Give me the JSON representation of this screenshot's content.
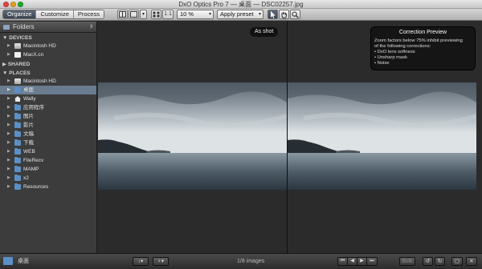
{
  "window": {
    "title": "DxO Optics Pro 7 — 桌面 — DSC02257.jpg"
  },
  "toolbar": {
    "tabs": [
      {
        "label": "Organize",
        "active": true
      },
      {
        "label": "Customize",
        "active": false
      },
      {
        "label": "Process",
        "active": false
      }
    ],
    "one_to_one_label": "1:1",
    "zoom_value": "10 %",
    "preset_label": "Apply preset"
  },
  "sidebar": {
    "header": "Folders",
    "sections": [
      {
        "title": "DEVICES",
        "items": [
          {
            "label": "Macintosh HD",
            "icon": "drive-icon"
          },
          {
            "label": "MacX.cn",
            "icon": "drive-icon"
          }
        ]
      },
      {
        "title": "SHARED",
        "items": []
      },
      {
        "title": "PLACES",
        "items": [
          {
            "label": "Macintosh HD",
            "icon": "drive-icon"
          },
          {
            "label": "桌面",
            "icon": "folder-icon",
            "selected": true
          },
          {
            "label": "Wally",
            "icon": "home-icon"
          },
          {
            "label": "应用程序",
            "icon": "folder-icon"
          },
          {
            "label": "图片",
            "icon": "folder-icon"
          },
          {
            "label": "影片",
            "icon": "folder-icon"
          },
          {
            "label": "文稿",
            "icon": "folder-icon"
          },
          {
            "label": "下载",
            "icon": "folder-icon"
          },
          {
            "label": "WEB",
            "icon": "folder-icon"
          },
          {
            "label": "FileRecv",
            "icon": "folder-icon"
          },
          {
            "label": "MAMP",
            "icon": "folder-icon"
          },
          {
            "label": "x2",
            "icon": "folder-icon"
          },
          {
            "label": "Resources",
            "icon": "folder-icon"
          }
        ]
      }
    ]
  },
  "viewer": {
    "as_shot_label": "As shot",
    "preview": {
      "title": "Correction Preview",
      "lines": [
        "Zoom factors below 75% inhibit previewing",
        "of the following corrections:",
        "• DxO lens softness",
        "• Unsharp mask",
        "• Noise"
      ]
    }
  },
  "bottombar": {
    "folder_label": "桌面",
    "image_count": "1/8 images",
    "bulk_label": "Bulk"
  },
  "colors": {
    "accent": "#5f6a78",
    "selection": "#6a7c90",
    "folder": "#5b8fc6"
  }
}
